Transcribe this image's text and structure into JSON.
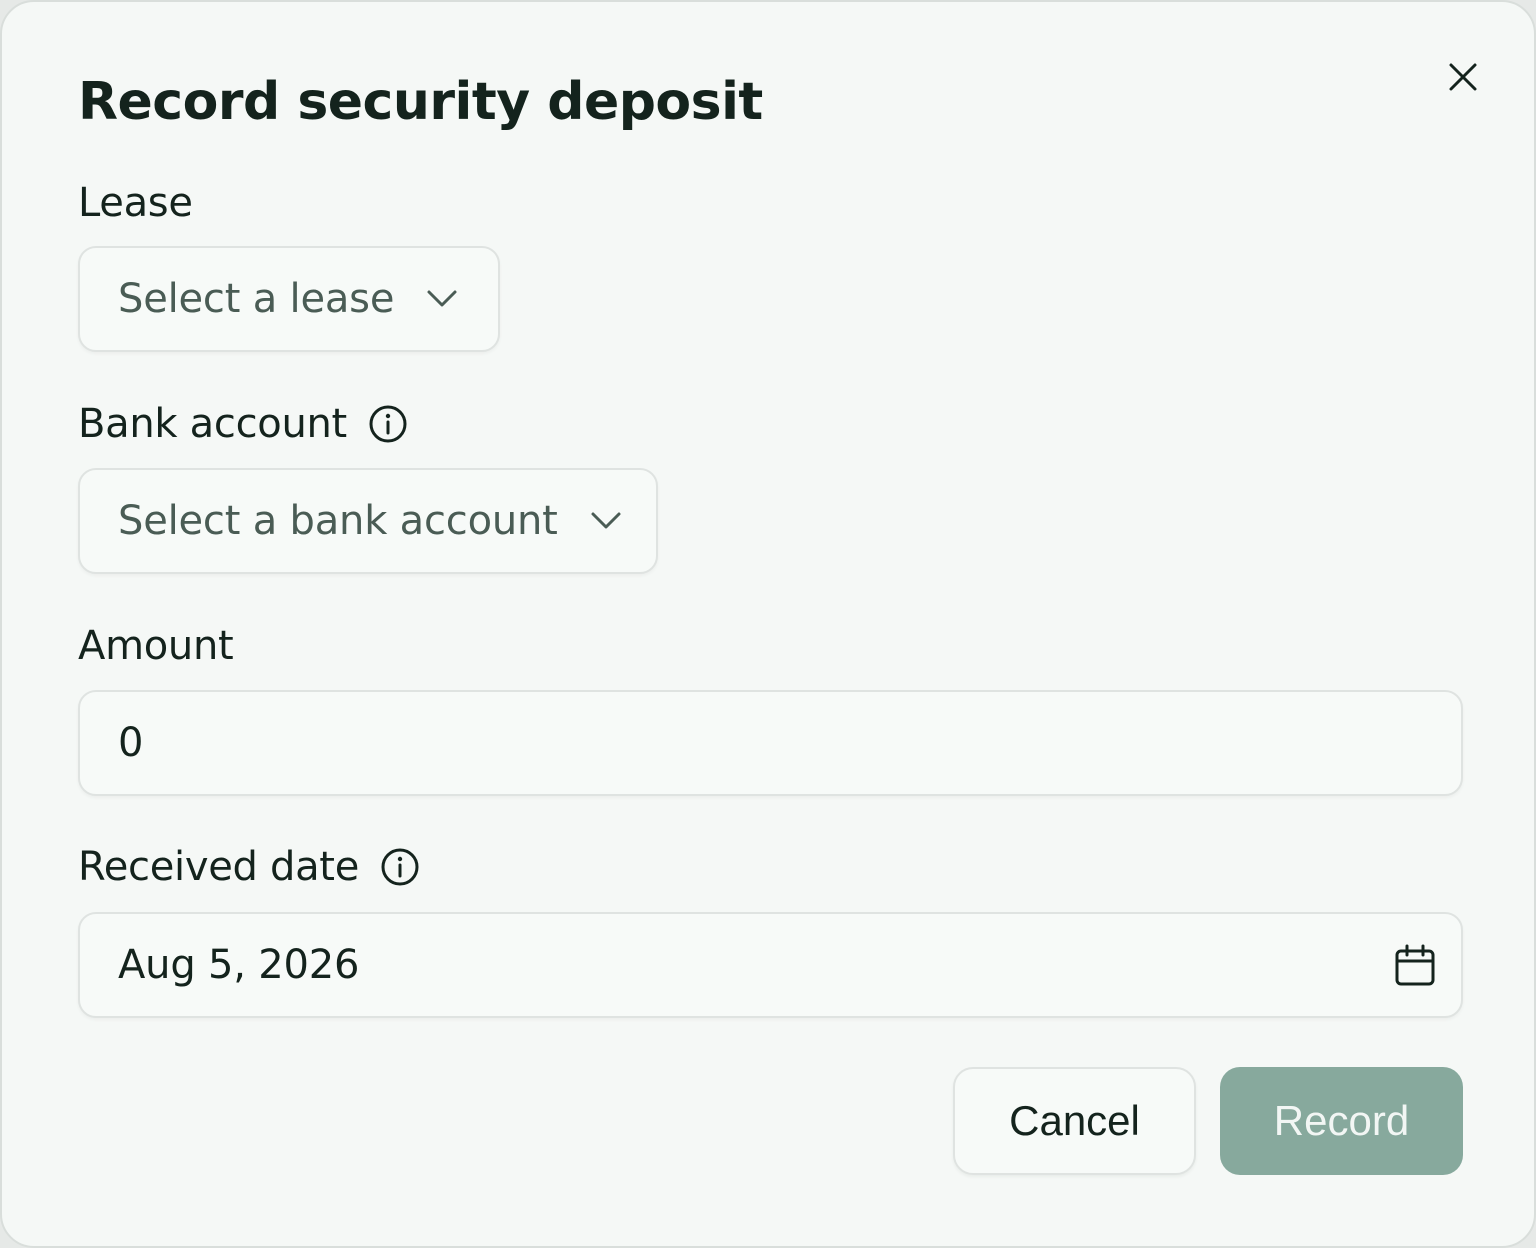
{
  "dialog": {
    "title": "Record security deposit",
    "close_icon": "close-icon"
  },
  "fields": {
    "lease": {
      "label": "Lease",
      "placeholder": "Select a lease"
    },
    "bank_account": {
      "label": "Bank account",
      "placeholder": "Select a bank account",
      "info_icon": "info-icon"
    },
    "amount": {
      "label": "Amount",
      "value": "0"
    },
    "received_date": {
      "label": "Received date",
      "value": "Aug 5, 2026",
      "info_icon": "info-icon",
      "picker_icon": "calendar-icon"
    }
  },
  "actions": {
    "cancel_label": "Cancel",
    "record_label": "Record"
  },
  "colors": {
    "primary_disabled": "#87a99d",
    "text": "#14231d",
    "background": "#f5f8f6"
  }
}
